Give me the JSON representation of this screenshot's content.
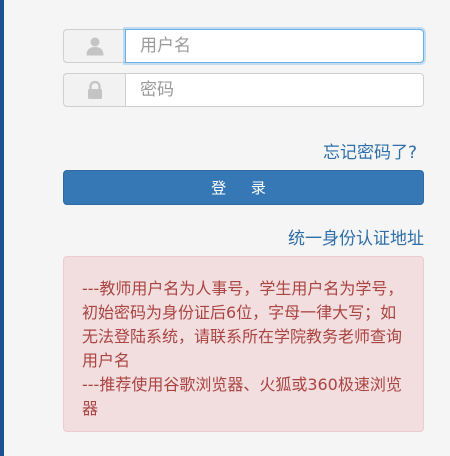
{
  "username": {
    "placeholder": "用户名",
    "icon": "user-icon"
  },
  "password": {
    "placeholder": "密码",
    "icon": "lock-icon"
  },
  "forgot_password": "忘记密码了?",
  "login_button": "登 录",
  "unified_auth": "统一身份认证地址",
  "notice": {
    "line1": "---教师用户名为人事号，学生用户名为学号，初始密码为身份证后6位，字母一律大写；如无法登陆系统，请联系所在学院教务老师查询用户名",
    "line2": "---推荐使用谷歌浏览器、火狐或360极速浏览器"
  },
  "colors": {
    "accent": "#3678b5",
    "link": "#2f6fa8",
    "notice_bg": "#f2dede",
    "notice_text": "#a94442"
  }
}
